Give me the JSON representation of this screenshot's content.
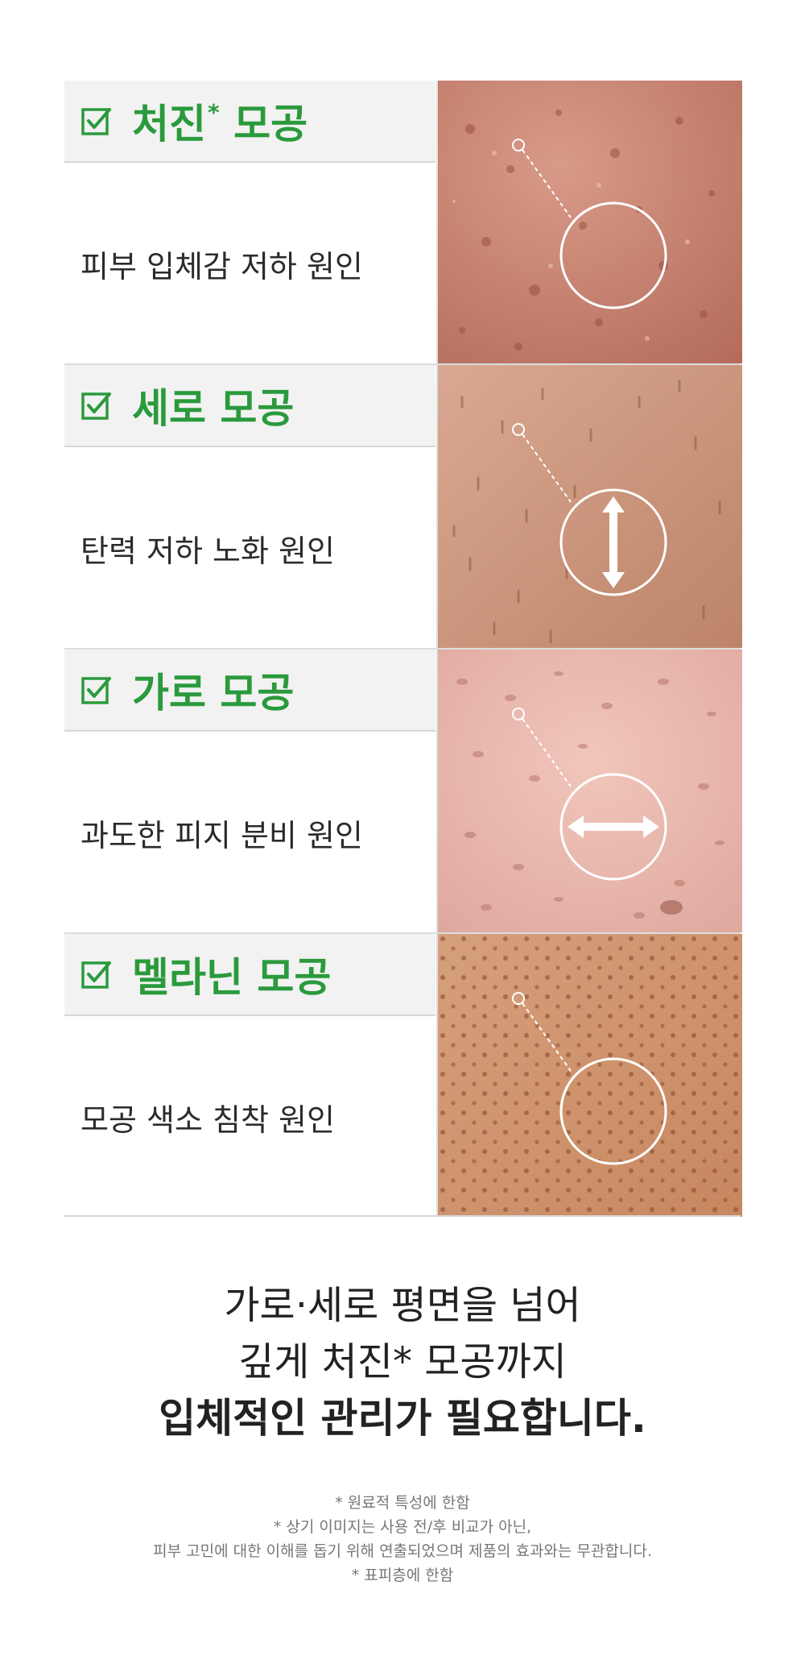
{
  "items": [
    {
      "title": "처진",
      "title_mark": "*",
      "title_suffix": " 모공",
      "description": "피부 입체감 저하 원인",
      "icon": "circle-focus-icon",
      "skin_tone": "#c98572"
    },
    {
      "title": "세로 모공",
      "title_mark": "",
      "title_suffix": "",
      "description": "탄력 저하 노화 원인",
      "icon": "vertical-arrow-icon",
      "skin_tone": "#cf9a80"
    },
    {
      "title": "가로 모공",
      "title_mark": "",
      "title_suffix": "",
      "description": "과도한 피지 분비 원인",
      "icon": "horizontal-arrow-icon",
      "skin_tone": "#e8b5a8"
    },
    {
      "title": "멜라닌 모공",
      "title_mark": "",
      "title_suffix": "",
      "description": "모공 색소 침착 원인",
      "icon": "circle-focus-icon",
      "skin_tone": "#d49a74"
    }
  ],
  "headline": {
    "line1": "가로·세로 평면을 넘어",
    "line2": "깊게 처진* 모공까지",
    "line3": "입체적인 관리가 필요합니다."
  },
  "notes": [
    "* 원료적 특성에 한함",
    "* 상기 이미지는 사용 전/후 비교가 아닌,",
    "피부 고민에 대한 이해를 돕기 위해 연출되었으며 제품의 효과와는 무관합니다.",
    "* 표피층에 한함"
  ],
  "colors": {
    "accent_green": "#2a9a3c",
    "header_bg": "#f2f2f2"
  }
}
